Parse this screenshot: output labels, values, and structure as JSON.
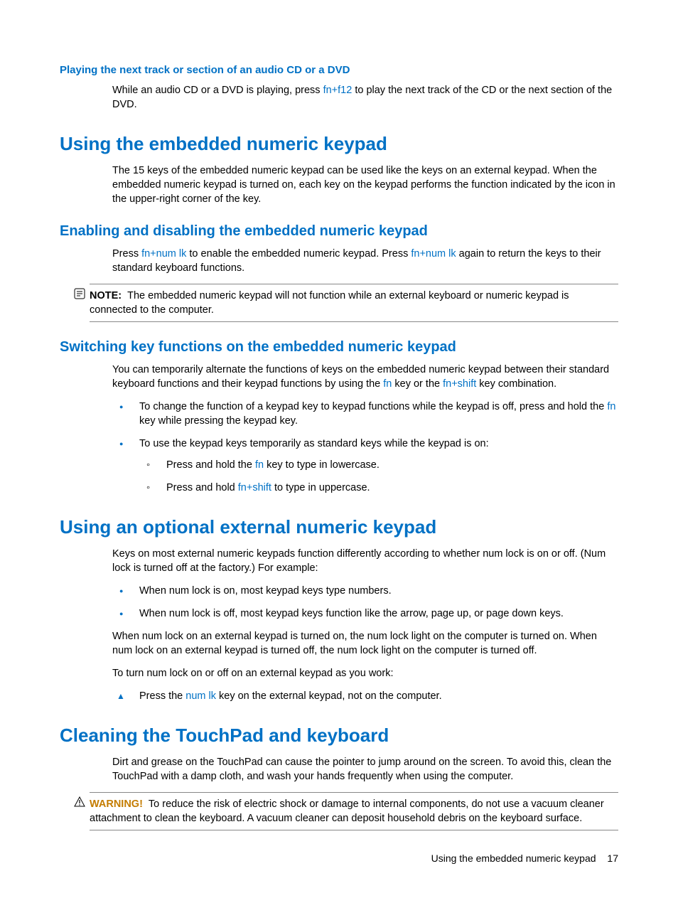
{
  "sections": {
    "playing_next": {
      "heading": "Playing the next track or section of an audio CD or a DVD",
      "p1a": "While an audio CD or a DVD is playing, press ",
      "hk1": "fn+f12",
      "p1b": " to play the next track of the CD or the next section of the DVD."
    },
    "embedded_keypad": {
      "heading": "Using the embedded numeric keypad",
      "p1": "The 15 keys of the embedded numeric keypad can be used like the keys on an external keypad. When the embedded numeric keypad is turned on, each key on the keypad performs the function indicated by the icon in the upper-right corner of the key."
    },
    "enable_disable": {
      "heading": "Enabling and disabling the embedded numeric keypad",
      "p1a": "Press ",
      "hk1": "fn+num lk",
      "p1b": " to enable the embedded numeric keypad. Press ",
      "hk2": "fn+num lk",
      "p1c": " again to return the keys to their standard keyboard functions.",
      "note_label": "NOTE:",
      "note_text": "The embedded numeric keypad will not function while an external keyboard or numeric keypad is connected to the computer."
    },
    "switching": {
      "heading": "Switching key functions on the embedded numeric keypad",
      "p1a": "You can temporarily alternate the functions of keys on the embedded numeric keypad between their standard keyboard functions and their keypad functions by using the ",
      "hk1": "fn",
      "p1b": " key or the ",
      "hk2": "fn+shift",
      "p1c": " key combination.",
      "b1a": "To change the function of a keypad key to keypad functions while the keypad is off, press and hold the ",
      "b1hk": "fn",
      "b1b": " key while pressing the keypad key.",
      "b2": "To use the keypad keys temporarily as standard keys while the keypad is on:",
      "s1a": "Press and hold the ",
      "s1hk": "fn",
      "s1b": " key to type in lowercase.",
      "s2a": "Press and hold ",
      "s2hk": "fn+shift",
      "s2b": " to type in uppercase."
    },
    "external_keypad": {
      "heading": "Using an optional external numeric keypad",
      "p1": "Keys on most external numeric keypads function differently according to whether num lock is on or off. (Num lock is turned off at the factory.) For example:",
      "b1": "When num lock is on, most keypad keys type numbers.",
      "b2": "When num lock is off, most keypad keys function like the arrow, page up, or page down keys.",
      "p2": "When num lock on an external keypad is turned on, the num lock light on the computer is turned on. When num lock on an external keypad is turned off, the num lock light on the computer is turned off.",
      "p3": "To turn num lock on or off on an external keypad as you work:",
      "step1a": "Press the ",
      "step1hk": "num lk",
      "step1b": " key on the external keypad, not on the computer."
    },
    "cleaning": {
      "heading": "Cleaning the TouchPad and keyboard",
      "p1": "Dirt and grease on the TouchPad can cause the pointer to jump around on the screen. To avoid this, clean the TouchPad with a damp cloth, and wash your hands frequently when using the computer.",
      "warning_label": "WARNING!",
      "warning_text": "To reduce the risk of electric shock or damage to internal components, do not use a vacuum cleaner attachment to clean the keyboard. A vacuum cleaner can deposit household debris on the keyboard surface."
    }
  },
  "footer": {
    "section_title": "Using the embedded numeric keypad",
    "page_number": "17"
  }
}
